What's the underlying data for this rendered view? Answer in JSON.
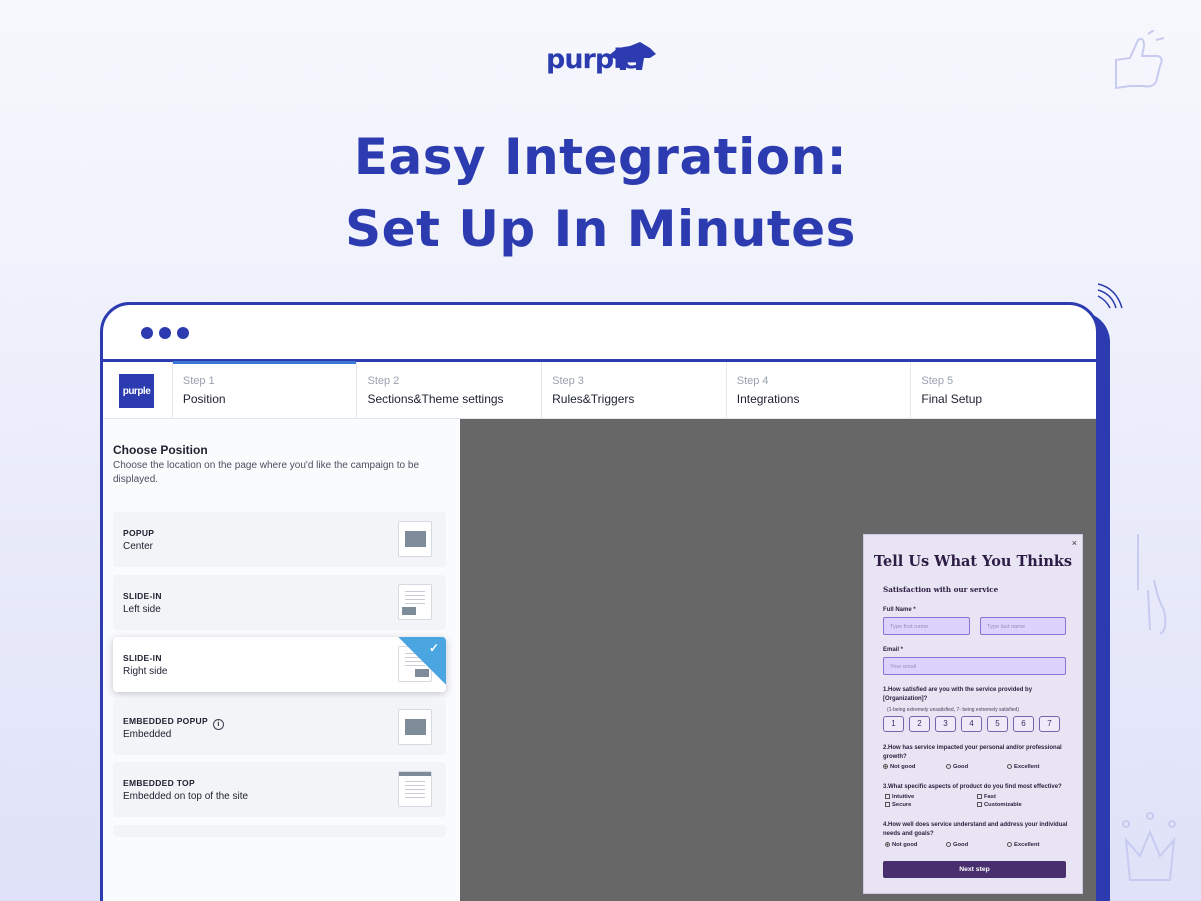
{
  "brand": {
    "name": "purple",
    "color": "#2c3cb0"
  },
  "headline": {
    "line1": "Easy Integration:",
    "line2": "Set Up In Minutes"
  },
  "app": {
    "logo_text": "purple",
    "steps": [
      {
        "num": "Step 1",
        "label": "Position",
        "active": true
      },
      {
        "num": "Step 2",
        "label": "Sections&Theme settings",
        "active": false
      },
      {
        "num": "Step 3",
        "label": "Rules&Triggers",
        "active": false
      },
      {
        "num": "Step 4",
        "label": "Integrations",
        "active": false
      },
      {
        "num": "Step 5",
        "label": "Final Setup",
        "active": false
      }
    ]
  },
  "position_panel": {
    "title": "Choose Position",
    "description": "Choose the location on the page where you'd like the campaign to be displayed.",
    "options": [
      {
        "type": "POPUP",
        "sub": "Center",
        "selected": false
      },
      {
        "type": "SLIDE-IN",
        "sub": "Left side",
        "selected": false
      },
      {
        "type": "SLIDE-IN",
        "sub": "Right side",
        "selected": true
      },
      {
        "type": "EMBEDDED POPUP",
        "sub": "Embedded",
        "selected": false,
        "info_icon": "i"
      },
      {
        "type": "EMBEDDED TOP",
        "sub": "Embedded on top of the site",
        "selected": false
      }
    ],
    "check_mark": "✓"
  },
  "survey": {
    "close": "×",
    "title": "Tell Us What You Thinks",
    "subtitle": "Satisfaction with our service",
    "full_name_label": "Full Name *",
    "first_name_placeholder": "Type first name",
    "last_name_placeholder": "Type last name",
    "email_label": "Email *",
    "email_placeholder": "Your email",
    "q1": "1.How satisfied are you with the service provided by [Organization]?",
    "q1_hint": "(1-being extremely unsatisfied, 7- being extremely satisfied)",
    "scale": [
      "1",
      "2",
      "3",
      "4",
      "5",
      "6",
      "7"
    ],
    "q2": "2.How has service impacted your personal and/or professional growth?",
    "q2_options": [
      "Not good",
      "Good",
      "Excellent"
    ],
    "q3": "3.What specific aspects of product do you find most effective?",
    "q3_options": [
      "Intuitive",
      "Fast",
      "Secure",
      "Customizable"
    ],
    "q4": "4.How well does service understand and address your individual needs and goals?",
    "q4_options": [
      "Not good",
      "Good",
      "Excellent"
    ],
    "next_button": "Next step"
  }
}
